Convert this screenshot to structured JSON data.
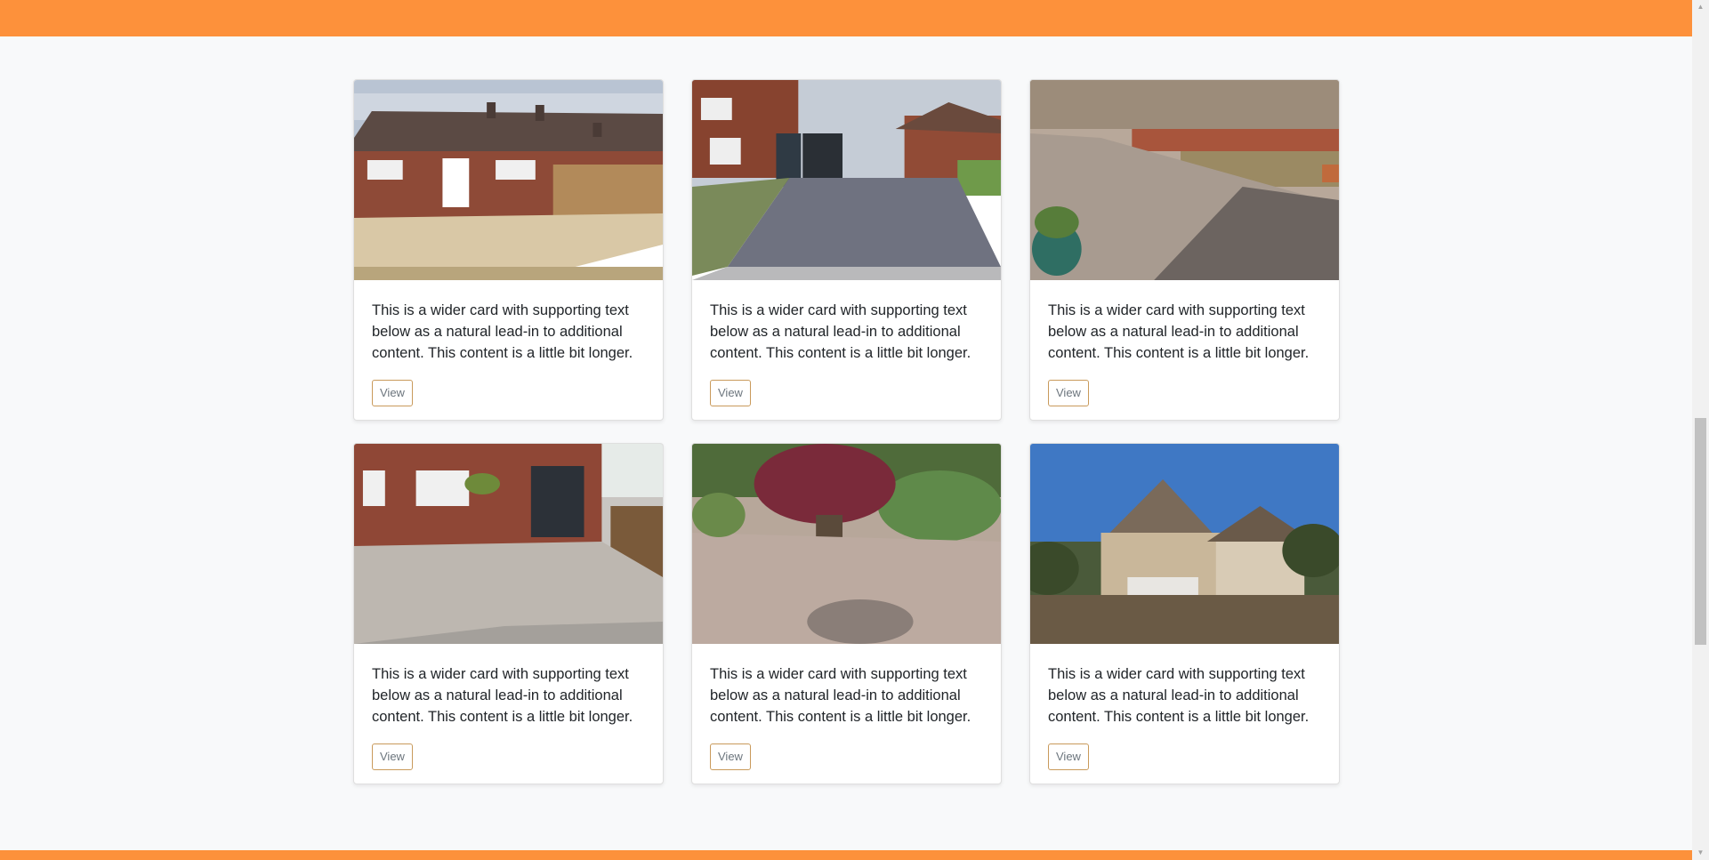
{
  "colors": {
    "brand_orange": "#fd913b",
    "button_border": "#c99a5b",
    "page_background": "#f8f9fa"
  },
  "cards": [
    {
      "image": "patio-sandstone-bungalow",
      "text": "This is a wider card with supporting text below as a natural lead-in to additional content. This content is a little bit longer.",
      "button_label": "View"
    },
    {
      "image": "block-paved-driveway",
      "text": "This is a wider card with supporting text below as a natural lead-in to additional content. This content is a little bit longer.",
      "button_label": "View"
    },
    {
      "image": "patio-garden-wall",
      "text": "This is a wider card with supporting text below as a natural lead-in to additional content. This content is a little bit longer.",
      "button_label": "View"
    },
    {
      "image": "patio-extension",
      "text": "This is a wider card with supporting text below as a natural lead-in to additional content. This content is a little bit longer.",
      "button_label": "View"
    },
    {
      "image": "patio-acer-tree",
      "text": "This is a wider card with supporting text below as a natural lead-in to additional content. This content is a little bit longer.",
      "button_label": "View"
    },
    {
      "image": "tudor-house",
      "text": "This is a wider card with supporting text below as a natural lead-in to additional content. This content is a little bit longer.",
      "button_label": "View"
    }
  ]
}
